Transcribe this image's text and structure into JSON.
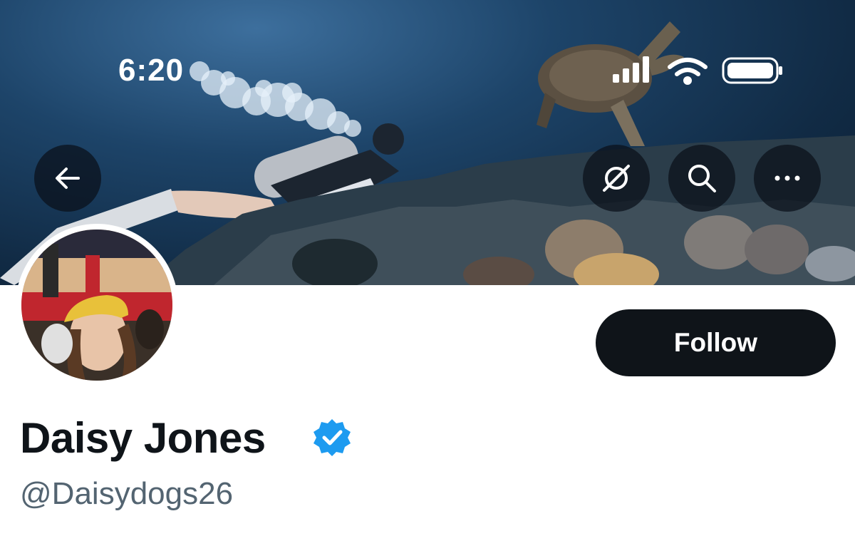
{
  "status_bar": {
    "time": "6:20",
    "icons": [
      "signal-icon",
      "wifi-icon",
      "battery-icon"
    ]
  },
  "header_actions": {
    "back": "arrow-left-icon",
    "grok": "grok-icon",
    "search": "search-icon",
    "more": "more-icon"
  },
  "profile": {
    "display_name": "Daisy Jones",
    "handle": "@Daisydogs26",
    "verified": true,
    "follow_label": "Follow"
  },
  "colors": {
    "verified_blue": "#1d9bf0",
    "follow_bg": "#0f1419",
    "handle_gray": "#536471"
  }
}
